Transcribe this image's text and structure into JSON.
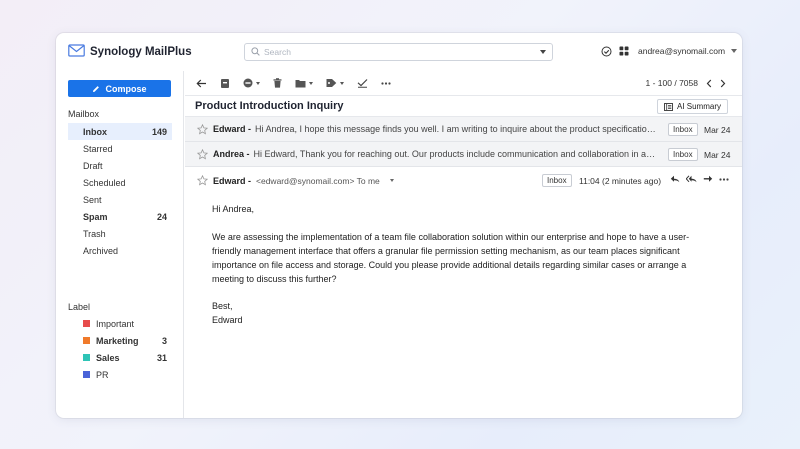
{
  "app": {
    "name": "Synology MailPlus",
    "brand_color": "#1a73e8"
  },
  "search": {
    "placeholder": "Search",
    "value": ""
  },
  "account": {
    "email": "andrea@synomail.com"
  },
  "sidebar": {
    "compose_label": "Compose",
    "mailbox_title": "Mailbox",
    "items": [
      {
        "label": "Inbox",
        "count": "149",
        "active": true
      },
      {
        "label": "Starred",
        "count": ""
      },
      {
        "label": "Draft",
        "count": ""
      },
      {
        "label": "Scheduled",
        "count": ""
      },
      {
        "label": "Sent",
        "count": ""
      },
      {
        "label": "Spam",
        "count": "24"
      },
      {
        "label": "Trash",
        "count": ""
      },
      {
        "label": "Archived",
        "count": ""
      }
    ],
    "label_title": "Label",
    "labels": [
      {
        "label": "Important",
        "count": "",
        "color": "#e74c4c"
      },
      {
        "label": "Marketing",
        "count": "3",
        "color": "#f07a2a"
      },
      {
        "label": "Sales",
        "count": "31",
        "color": "#2ec4b6"
      },
      {
        "label": "PR",
        "count": "",
        "color": "#4a63d8"
      }
    ]
  },
  "toolbar": {
    "icons": [
      "back-arrow-icon",
      "archive-icon",
      "block-icon",
      "trash-icon",
      "folder-icon",
      "tag-icon",
      "check-icon",
      "more-icon"
    ],
    "pager_text": "1 - 100 / 7058"
  },
  "thread": {
    "subject": "Product Introduction Inquiry",
    "ai_summary_label": "AI Summary",
    "collapsed": [
      {
        "sender": "Edward -",
        "snippet": "Hi Andrea, I hope this message finds you well. I am writing to inquire about the product specification...",
        "folder": "Inbox",
        "date": "Mar 24"
      },
      {
        "sender": "Andrea -",
        "snippet": "Hi Edward, Thank you for reaching out. Our products include communication and collaboration in a pr...",
        "folder": "Inbox",
        "date": "Mar 24"
      }
    ],
    "open": {
      "sender": "Edward -",
      "from_to": "<edward@synomail.com> To me",
      "folder": "Inbox",
      "time": "11:04 (2 minutes ago)",
      "greeting": "Hi Andrea,",
      "paragraph": "We are assessing the implementation of a team file collaboration solution within our enterprise and hope to have a user-friendly management interface that offers a granular file permission setting mechanism, as our team places significant importance on file access and storage. Could you please provide additional details regarding similar cases or arrange a meeting to discuss this further?",
      "closing": "Best,",
      "signature": "Edward"
    }
  }
}
